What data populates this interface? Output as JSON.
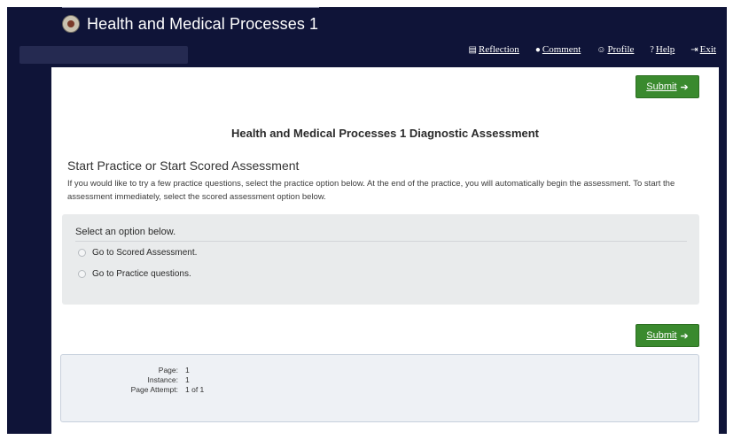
{
  "app": {
    "title": "Health and Medical Processes 1"
  },
  "nav": {
    "items": [
      {
        "label": "Reflection",
        "icon": "folder-icon",
        "glyph": "▤"
      },
      {
        "label": "Comment",
        "icon": "comment-icon",
        "glyph": "●"
      },
      {
        "label": "Profile",
        "icon": "user-icon",
        "glyph": "☺"
      },
      {
        "label": "Help",
        "icon": "help-icon",
        "glyph": "?"
      },
      {
        "label": "Exit",
        "icon": "exit-icon",
        "glyph": "⇥"
      }
    ]
  },
  "submit": {
    "label": "Submit",
    "arrow": "➔"
  },
  "assessment": {
    "title": "Health and Medical Processes 1 Diagnostic Assessment",
    "section_title": "Start Practice or Start Scored Assessment",
    "intro": "If you would like to try a few practice questions, select the practice option below.  At the end of the practice, you will automatically begin the assessment.  To start the assessment immediately, select the scored assessment option below."
  },
  "options": {
    "label": "Select an option below.",
    "items": [
      {
        "label": "Go to Scored Assessment."
      },
      {
        "label": "Go to Practice questions."
      }
    ]
  },
  "info": {
    "page_key": "Page:",
    "page_val": "1",
    "instance_key": "Instance:",
    "instance_val": "1",
    "attempt_key": "Page Attempt:",
    "attempt_val": "1 of 1"
  },
  "colors": {
    "frame_bg": "#0f1438",
    "submit_green": "#3a8a2e",
    "options_bg": "#e9ebec",
    "info_bg": "#eef1f5"
  }
}
